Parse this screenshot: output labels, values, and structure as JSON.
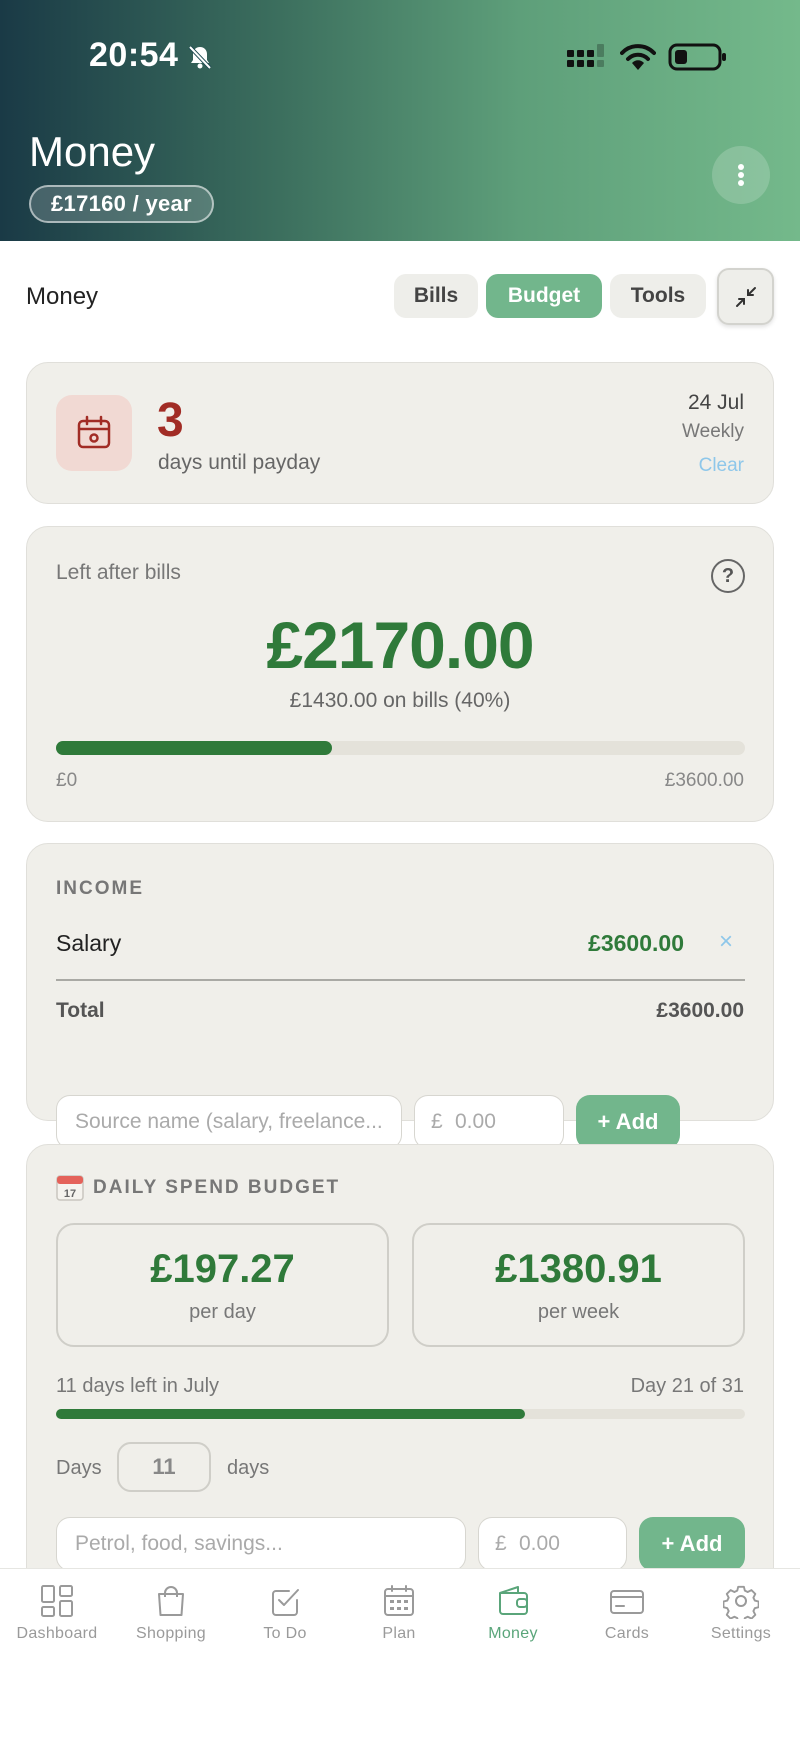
{
  "status_bar": {
    "time": "20:54"
  },
  "header": {
    "title": "Money",
    "salary_pill": "£17160 / year"
  },
  "section_nav": {
    "title": "Money",
    "tabs": [
      {
        "label": "Bills",
        "active": false
      },
      {
        "label": "Budget",
        "active": true
      },
      {
        "label": "Tools",
        "active": false
      }
    ]
  },
  "payday": {
    "count": "3",
    "label": "days until payday",
    "date": "24 Jul",
    "frequency": "Weekly",
    "clear_label": "Clear"
  },
  "left_after_bills": {
    "label": "Left after bills",
    "help": "?",
    "amount": "£2170.00",
    "subtext": "£1430.00 on bills (40%)",
    "progress_fraction": 0.4,
    "min_label": "£0",
    "max_label": "£3600.00"
  },
  "income": {
    "heading": "INCOME",
    "rows": [
      {
        "name": "Salary",
        "amount": "£3600.00",
        "remove": "×"
      }
    ],
    "total_label": "Total",
    "total_value": "£3600.00",
    "source_placeholder": "Source name (salary, freelance...)",
    "currency_symbol": "£",
    "amount_placeholder": "0.00",
    "add_label": "+ Add"
  },
  "daily_budget": {
    "heading": "DAILY SPEND BUDGET",
    "per_day_amount": "£197.27",
    "per_day_label": "per day",
    "per_week_amount": "£1380.91",
    "per_week_label": "per week",
    "days_left_text": "11 days left in July",
    "day_of_month_text": "Day 21 of 31",
    "month_progress_fraction": 0.68,
    "days_label": "Days",
    "days_value": "11",
    "days_unit": "days",
    "expense_placeholder": "Petrol, food, savings...",
    "currency_symbol": "£",
    "amount_placeholder": "0.00",
    "add_label": "+ Add"
  },
  "bottom_nav": {
    "items": [
      {
        "label": "Dashboard",
        "icon": "dashboard-icon",
        "active": false
      },
      {
        "label": "Shopping",
        "icon": "shopping-bag-icon",
        "active": false
      },
      {
        "label": "To Do",
        "icon": "checkbox-icon",
        "active": false
      },
      {
        "label": "Plan",
        "icon": "calendar-icon",
        "active": false
      },
      {
        "label": "Money",
        "icon": "wallet-icon",
        "active": true
      },
      {
        "label": "Cards",
        "icon": "card-icon",
        "active": false
      },
      {
        "label": "Settings",
        "icon": "gear-icon",
        "active": false
      }
    ]
  },
  "colors": {
    "accent_green": "#72b68c",
    "amount_green": "#2f7a3a",
    "payday_red": "#a12c25",
    "clear_blue": "#8ec7ea"
  }
}
